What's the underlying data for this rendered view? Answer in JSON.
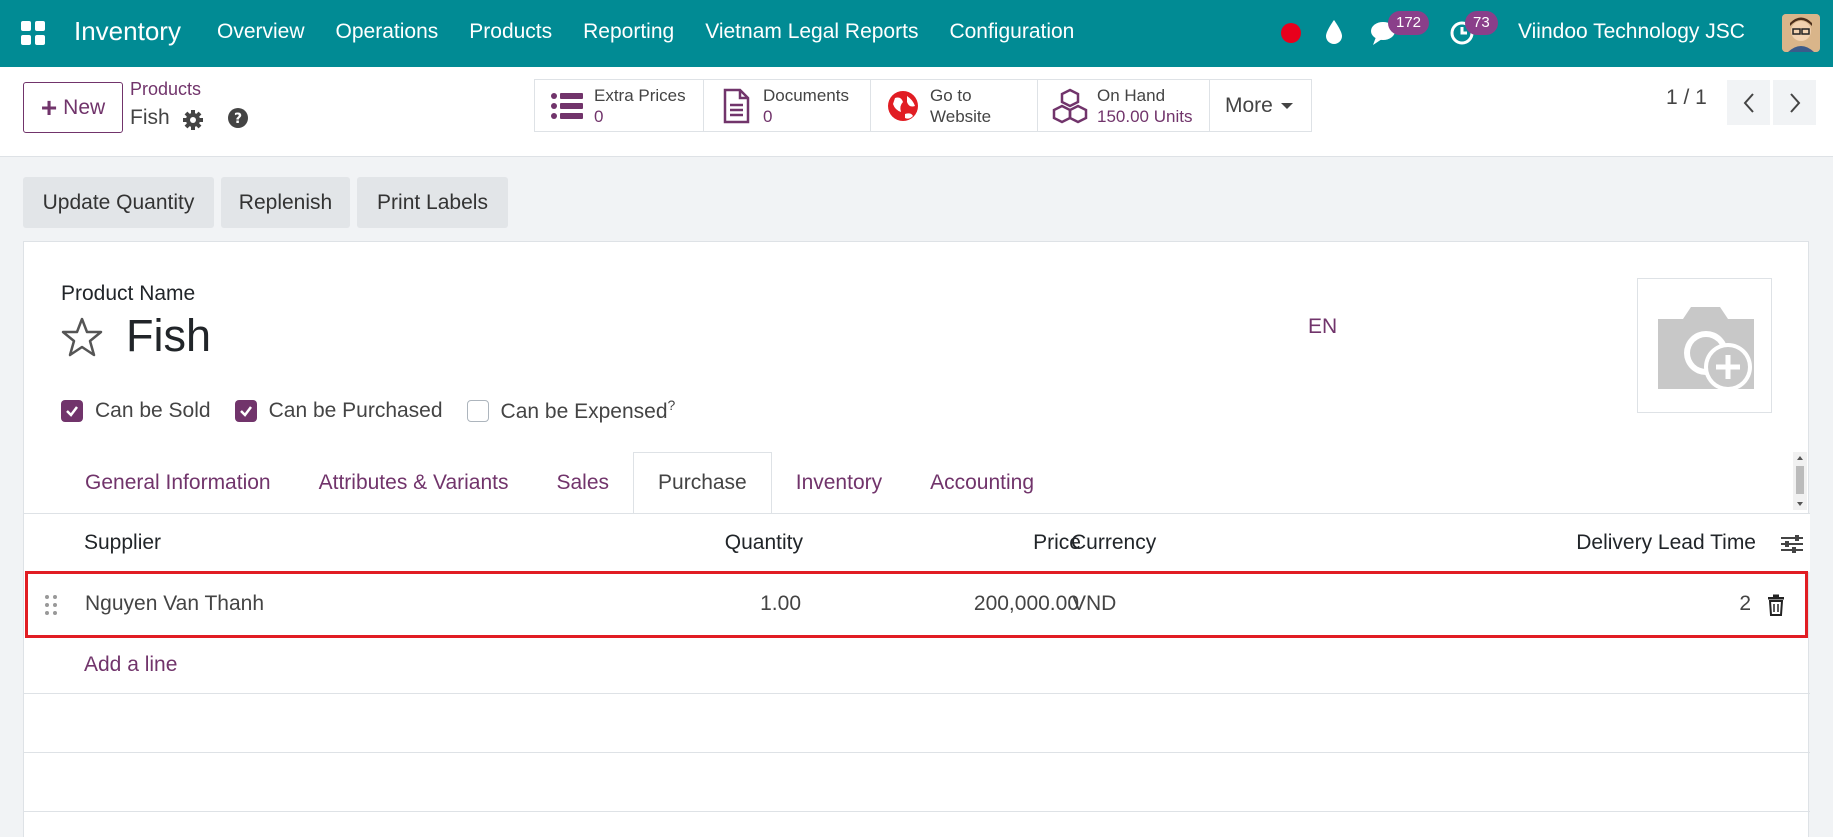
{
  "navbar": {
    "app_name": "Inventory",
    "menu": [
      "Overview",
      "Operations",
      "Products",
      "Reporting",
      "Vietnam Legal Reports",
      "Configuration"
    ],
    "messages_count": "172",
    "activities_count": "73",
    "company": "Viindoo Technology JSC",
    "icons": [
      "apps-grid-icon",
      "recording-dot-icon",
      "drop-icon",
      "chat-icon",
      "clock-icon",
      "avatar"
    ]
  },
  "control": {
    "new_label": "New",
    "breadcrumb_parent": "Products",
    "breadcrumb_current": "Fish",
    "smart_buttons": [
      {
        "label": "Extra Prices",
        "value": "0",
        "icon": "list-icon"
      },
      {
        "label": "Documents",
        "value": "0",
        "icon": "document-icon"
      },
      {
        "label": "Go to",
        "label2": "Website",
        "icon": "globe-icon"
      },
      {
        "label": "On Hand",
        "value": "150.00 Units",
        "icon": "cubes-icon"
      }
    ],
    "more_label": "More",
    "pager": "1 / 1"
  },
  "actions": [
    "Update Quantity",
    "Replenish",
    "Print Labels"
  ],
  "form": {
    "product_name_label": "Product Name",
    "product_name": "Fish",
    "lang": "EN",
    "checkboxes": [
      {
        "label": "Can be Sold",
        "checked": true
      },
      {
        "label": "Can be Purchased",
        "checked": true
      },
      {
        "label": "Can be Expensed",
        "checked": false,
        "sup": "?"
      }
    ],
    "tabs": [
      "General Information",
      "Attributes & Variants",
      "Sales",
      "Purchase",
      "Inventory",
      "Accounting"
    ],
    "active_tab": "Purchase",
    "table": {
      "headers": [
        "Supplier",
        "Quantity",
        "Price",
        "Currency",
        "Delivery Lead Time"
      ],
      "rows": [
        {
          "supplier": "Nguyen Van Thanh",
          "quantity": "1.00",
          "price": "200,000.00",
          "currency": "VND",
          "lead_time": "2"
        }
      ],
      "add_line": "Add a line"
    }
  },
  "colors": {
    "navbar": "#018b94",
    "brand": "#71346b",
    "highlight": "#e11d23"
  }
}
